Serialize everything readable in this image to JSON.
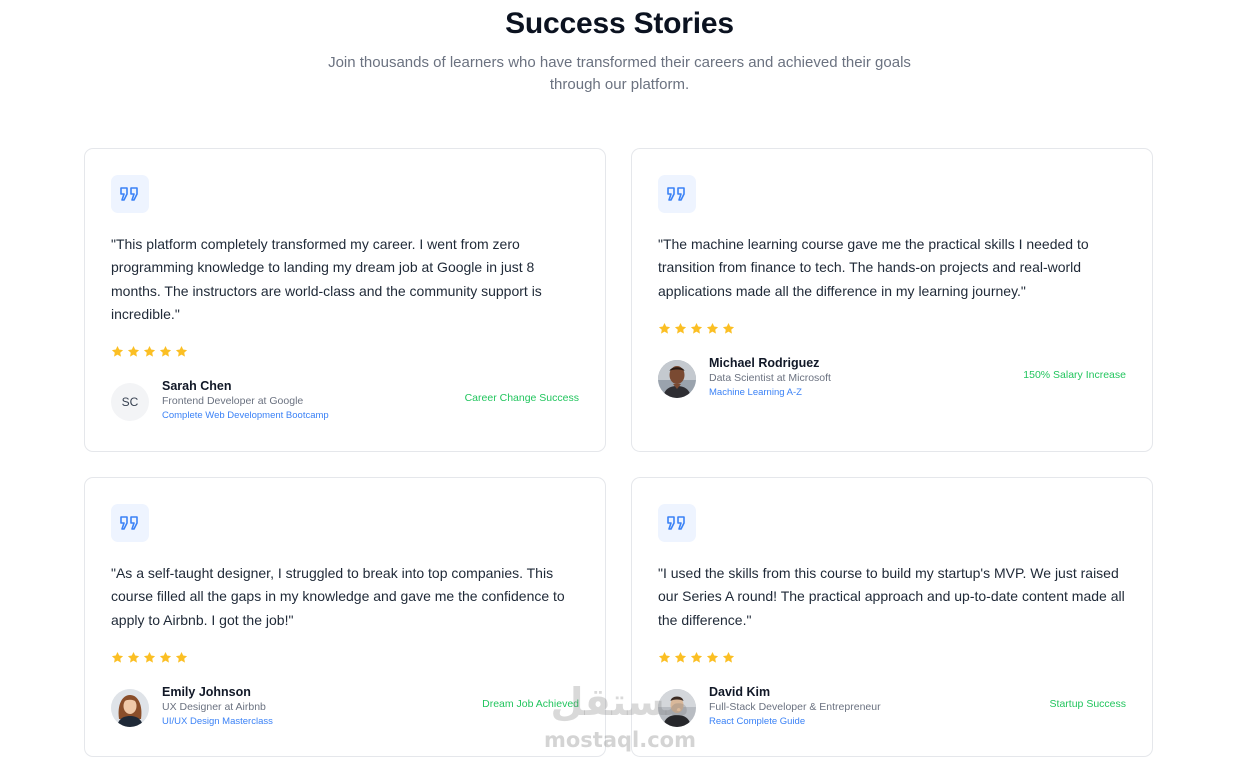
{
  "header": {
    "title": "Success Stories",
    "subtitle": "Join thousands of learners who have transformed their careers and achieved their goals through our platform."
  },
  "colors": {
    "accent_blue": "#3b82f6",
    "success_green": "#22c55e",
    "star_gold": "#fbbf24",
    "badge_bg": "#eef4ff"
  },
  "testimonials": [
    {
      "quote": "\"This platform completely transformed my career. I went from zero programming knowledge to landing my dream job at Google in just 8 months. The instructors are world-class and the community support is incredible.\"",
      "rating": 5,
      "name": "Sarah Chen",
      "role": "Frontend Developer at Google",
      "course": "Complete Web Development Bootcamp",
      "outcome": "Career Change Success",
      "avatar_initials": "SC",
      "avatar_icon": "initials-avatar"
    },
    {
      "quote": "\"The machine learning course gave me the practical skills I needed to transition from finance to tech. The hands-on projects and real-world applications made all the difference in my learning journey.\"",
      "rating": 5,
      "name": "Michael Rodriguez",
      "role": "Data Scientist at Microsoft",
      "course": "Machine Learning A-Z",
      "outcome": "150% Salary Increase",
      "avatar_icon": "photo-avatar"
    },
    {
      "quote": "\"As a self-taught designer, I struggled to break into top companies. This course filled all the gaps in my knowledge and gave me the confidence to apply to Airbnb. I got the job!\"",
      "rating": 5,
      "name": "Emily Johnson",
      "role": "UX Designer at Airbnb",
      "course": "UI/UX Design Masterclass",
      "outcome": "Dream Job Achieved",
      "avatar_icon": "photo-avatar"
    },
    {
      "quote": "\"I used the skills from this course to build my startup's MVP. We just raised our Series A round! The practical approach and up-to-date content made all the difference.\"",
      "rating": 5,
      "name": "David Kim",
      "role": "Full-Stack Developer & Entrepreneur",
      "course": "React Complete Guide",
      "outcome": "Startup Success",
      "avatar_icon": "photo-avatar"
    }
  ],
  "watermark": {
    "arabic": "مستقل",
    "latin": "mostaql.com"
  }
}
